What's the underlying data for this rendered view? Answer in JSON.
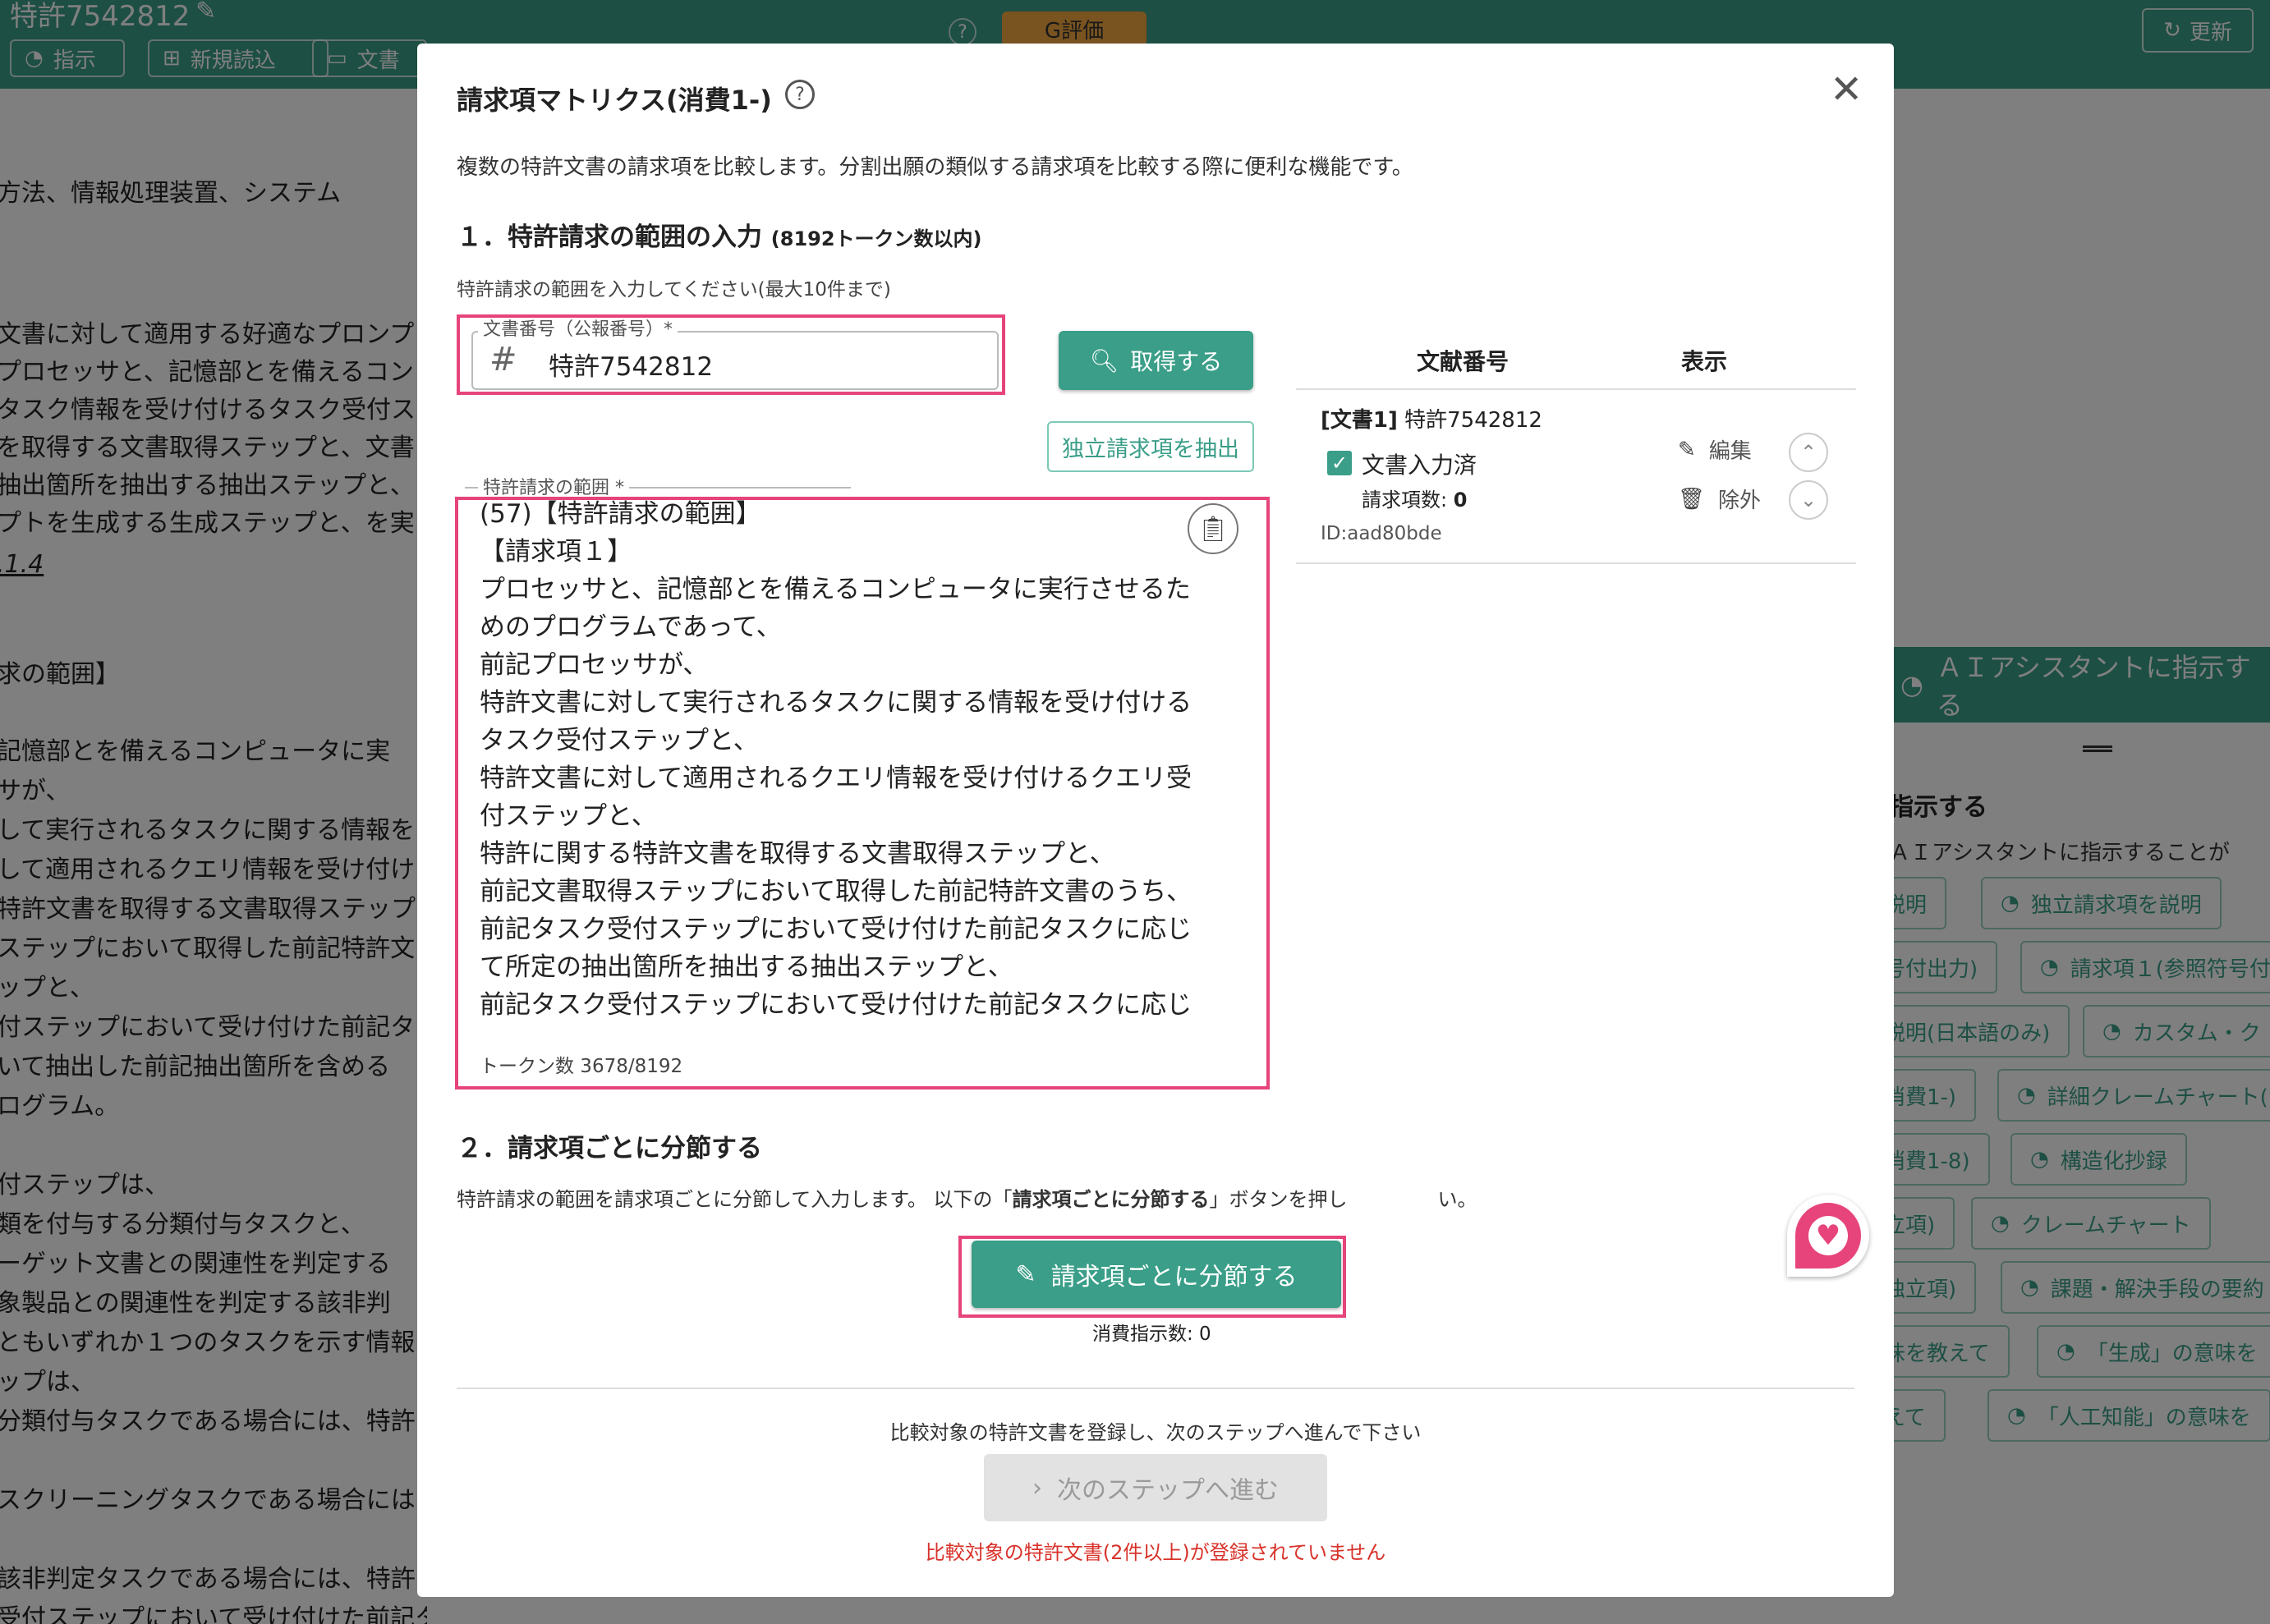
{
  "topbar": {
    "title": "特許7542812",
    "buttons": [
      "指示",
      "新規読込",
      "文書"
    ],
    "eval_badge": "G評価",
    "help": "?",
    "update": "更新"
  },
  "doc_lines": [
    "方法、情報処理装置、システム",
    "文書に対して適用する好適なプロンプ",
    "プロセッサと、記憶部とを備えるコン",
    "タスク情報を受け付けるタスク受付ス",
    "を取得する文書取得ステップと、文書",
    "抽出箇所を抽出する抽出ステップと、",
    "プトを生成する生成ステップと、を実",
    ".1.4",
    "求の範囲】",
    "記憶部とを備えるコンピュータに実",
    "サが、",
    "して実行されるタスクに関する情報を",
    "して適用されるクエリ情報を受け付け",
    "特許文書を取得する文書取得ステップ",
    "ステップにおいて取得した前記特許文",
    "ップと、",
    "付ステップにおいて受け付けた前記タ",
    "いて抽出した前記抽出箇所を含める",
    "ログラム。",
    "付ステップは、",
    "類を付与する分類付与タスクと、",
    "ーゲット文書との関連性を判定する",
    "象製品との関連性を判定する該非判",
    "ともいずれか１つのタスクを示す情報",
    "ップは、",
    "分類付与タスクである場合には、特許",
    "スクリーニングタスクである場合には",
    "該非判定タスクである場合には、特許",
    "受付ステップにおいて受け付けた前記タスクを示す情報に応じた異なる前記所定の抽出箇所を抽出可能"
  ],
  "right_panel": {
    "ai_assist": "ＡＩアシスタントに指示する",
    "instruct_heading": "指示する",
    "instruct_desc": "ＡＩアシスタントに指示することが",
    "chips": [
      "説明",
      "独立請求項を説明",
      "号付出力)",
      "請求項１(参照符号付",
      "説明(日本語のみ)",
      "カスタム・ク",
      "消費1-)",
      "詳細クレームチャート(",
      "消費1-8)",
      "構造化抄録",
      "立項)",
      "クレームチャート",
      "独立項)",
      "課題・解決手段の要約",
      "味を教えて",
      "「生成」の意味を",
      "えて",
      "「人工知能」の意味を"
    ]
  },
  "modal": {
    "title": "請求項マトリクス(消費1-)",
    "help": "?",
    "close": "✕",
    "description": "複数の特許文書の請求項を比較します。分割出願の類似する請求項を比較する際に便利な機能です。",
    "section1_title": "１．特許請求の範囲の入力",
    "section1_note": "(8192トークン数以内)",
    "section1_instruction": "特許請求の範囲を入力してください(最大10件まで)",
    "doc_field_label": "文書番号（公報番号）*",
    "doc_field_value": "特許7542812",
    "get_button": "取得する",
    "extract_button": "独立請求項を抽出",
    "claims_label": "特許請求の範囲 *",
    "claims_lines": [
      "(57)【特許請求の範囲】",
      "【請求項１】",
      "プロセッサと、記憶部とを備えるコンピュータに実行させるた",
      "めのプログラムであって、",
      "前記プロセッサが、",
      "特許文書に対して実行されるタスクに関する情報を受け付ける",
      "タスク受付ステップと、",
      "特許文書に対して適用されるクエリ情報を受け付けるクエリ受",
      "付ステップと、",
      "特許に関する特許文書を取得する文書取得ステップと、",
      "前記文書取得ステップにおいて取得した前記特許文書のうち、",
      "前記タスク受付ステップにおいて受け付けた前記タスクに応じ",
      "て所定の抽出箇所を抽出する抽出ステップと、",
      "前記タスク受付ステップにおいて受け付けた前記タスクに応じ"
    ],
    "token_count": "トークン数 3678/8192",
    "table": {
      "col_doc": "文献番号",
      "col_view": "表示",
      "row_tag": "[文書1]",
      "row_doc": "特許7542812",
      "row_status": "文書入力済",
      "row_count_label": "請求項数:",
      "row_count": "0",
      "row_id": "ID:aad80bde",
      "edit": "編集",
      "remove": "除外"
    },
    "section2_title": "２．請求項ごとに分節する",
    "section2_instruction_a": "特許請求の範囲を請求項ごとに分節して入力します。 以下の「",
    "section2_instruction_b": "請求項ごとに分節する",
    "section2_instruction_c": "」ボタンを押し",
    "section2_instruction_d": "い。",
    "split_button": "請求項ごとに分節する",
    "consumption": "消費指示数: 0",
    "next_instruction": "比較対象の特許文書を登録し、次のステップへ進んで下さい",
    "next_button": "次のステップへ進む",
    "error": "比較対象の特許文書(2件以上)が登録されていません"
  },
  "colors": {
    "accent": "#3a9e88",
    "highlight": "#e6447a",
    "error": "#d8322a"
  }
}
